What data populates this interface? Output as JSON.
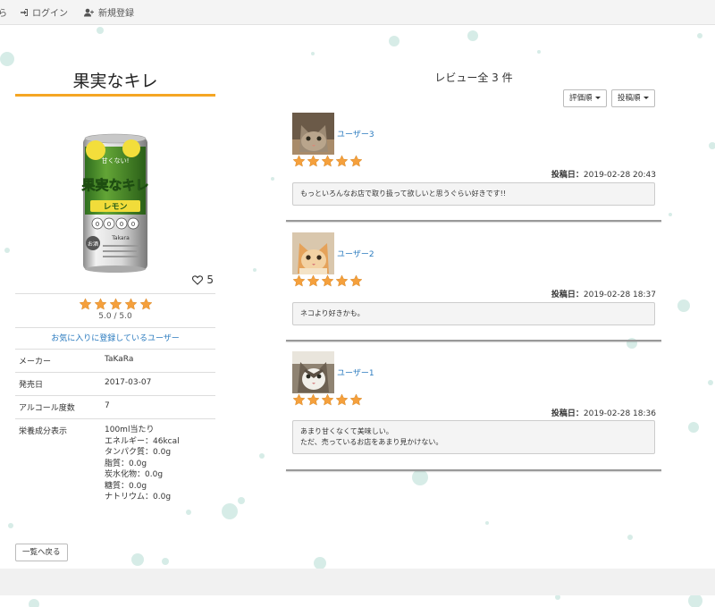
{
  "nav": {
    "cut_label": "ら",
    "login_label": "ログイン",
    "register_label": "新規登録"
  },
  "product": {
    "name": "果実なキレ",
    "likes": "5",
    "rating_display": "5.0 / 5.0",
    "rating_value": 5,
    "favorite_users_link": "お気に入りに登録しているユーザー",
    "specs": [
      {
        "key": "メーカー",
        "value": "TaKaRa"
      },
      {
        "key": "発売日",
        "value": "2017-03-07"
      },
      {
        "key": "アルコール度数",
        "value": "7"
      }
    ],
    "nutrition": {
      "key": "栄養成分表示",
      "lines": [
        "100ml当たり",
        "エネルギー：46kcal",
        "タンパク質：0.0g",
        "脂質：0.0g",
        "炭水化物：0.0g",
        "糖質：0.0g",
        "ナトリウム：0.0g"
      ]
    },
    "can_text": {
      "brand": "果実なキレ",
      "flavor": "レモン",
      "tagline": "甘くない!",
      "badge": "お酒",
      "maker": "Takara",
      "zeros": [
        "0",
        "0",
        "0",
        "0"
      ]
    }
  },
  "back_button": "一覧へ戻る",
  "reviews_header": "レビュー全 3 件",
  "sort": {
    "rating_label": "評価順",
    "date_label": "投稿順"
  },
  "posted_label": "投稿日：",
  "reviews": [
    {
      "user": "ユーザー3",
      "rating": 5,
      "date": "2019-02-28 20:43",
      "comment": [
        "もっといろんなお店で取り扱って欲しいと思うぐらい好きです!!"
      ]
    },
    {
      "user": "ユーザー2",
      "rating": 5,
      "date": "2019-02-28 18:37",
      "comment": [
        "ネコより好きかも。"
      ]
    },
    {
      "user": "ユーザー1",
      "rating": 5,
      "date": "2019-02-28 18:36",
      "comment": [
        "あまり甘くなくて美味しい。",
        "ただ、売っているお店をあまり見かけない。"
      ]
    }
  ],
  "colors": {
    "accent": "#f5a623",
    "link": "#2b7bbf",
    "star": "#f5a03c",
    "dots": "#c9e6df"
  }
}
